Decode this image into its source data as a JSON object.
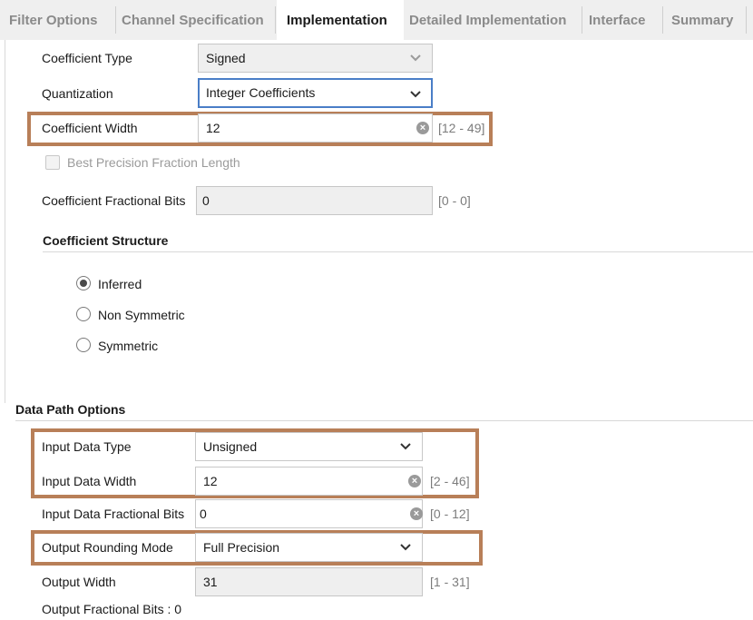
{
  "tabs": [
    {
      "label": "Filter Options"
    },
    {
      "label": "Channel Specification"
    },
    {
      "label": "Implementation"
    },
    {
      "label": "Detailed Implementation"
    },
    {
      "label": "Interface"
    },
    {
      "label": "Summary"
    }
  ],
  "active_tab": "Implementation",
  "coefficient": {
    "type": {
      "label": "Coefficient Type",
      "value": "Signed"
    },
    "quantization": {
      "label": "Quantization",
      "value": "Integer Coefficients"
    },
    "width": {
      "label": "Coefficient Width",
      "value": "12",
      "range": "[12 - 49]"
    },
    "best_precision": {
      "label": "Best Precision Fraction Length",
      "checked": false
    },
    "fractional_bits": {
      "label": "Coefficient Fractional Bits",
      "value": "0",
      "range": "[0 - 0]"
    }
  },
  "structure": {
    "heading": "Coefficient Structure",
    "options": [
      {
        "label": "Inferred",
        "selected": true
      },
      {
        "label": "Non Symmetric",
        "selected": false
      },
      {
        "label": "Symmetric",
        "selected": false
      }
    ]
  },
  "datapath": {
    "heading": "Data Path Options",
    "input_type": {
      "label": "Input Data Type",
      "value": "Unsigned"
    },
    "input_width": {
      "label": "Input Data Width",
      "value": "12",
      "range": "[2 - 46]"
    },
    "input_frac": {
      "label": "Input Data Fractional Bits",
      "value": "0",
      "range": "[0 - 12]"
    },
    "rounding": {
      "label": "Output Rounding Mode",
      "value": "Full Precision"
    },
    "output_width": {
      "label": "Output Width",
      "value": "31",
      "range": "[1 - 31]"
    },
    "output_frac": {
      "label": "Output Fractional Bits : 0"
    }
  },
  "colors": {
    "highlight": "#b87f58",
    "focus": "#4a7ec7"
  },
  "icons": {
    "dropdown": "chevron-down-icon",
    "clear": "clear-icon"
  }
}
